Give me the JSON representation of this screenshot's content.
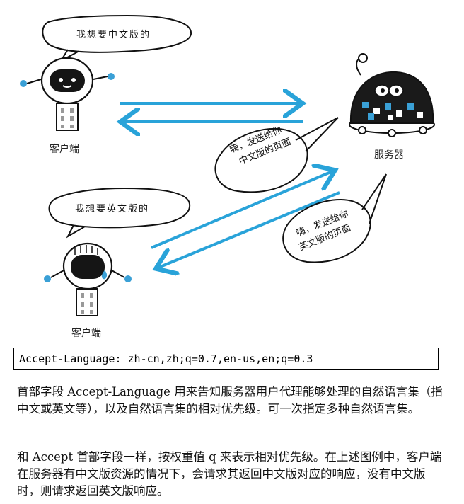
{
  "illustration": {
    "client_top": {
      "speech": "我想要中文版的",
      "label": "客户端"
    },
    "client_bottom": {
      "speech": "我想要英文版的",
      "label": "客户端"
    },
    "server": {
      "label": "服务器",
      "reply_chinese": [
        "嗨，发送给你",
        "中文版的页面"
      ],
      "reply_english": [
        "嗨，发送给你",
        "英文版的页面"
      ]
    },
    "colors": {
      "arrow": "#29a3d9",
      "robot_dark": "#111111",
      "robot_accent": "#3aa0d6"
    }
  },
  "code": "Accept-Language: zh-cn,zh;q=0.7,en-us,en;q=0.3",
  "paragraphs": [
    "首部字段 Accept-Language 用来告知服务器用户代理能够处理的自然语言集（指中文或英文等），以及自然语言集的相对优先级。可一次指定多种自然语言集。",
    "和 Accept 首部字段一样，按权重值 q 来表示相对优先级。在上述图例中，客户端在服务器有中文版资源的情况下，会请求其返回中文版对应的响应，没有中文版时，则请求返回英文版响应。"
  ]
}
